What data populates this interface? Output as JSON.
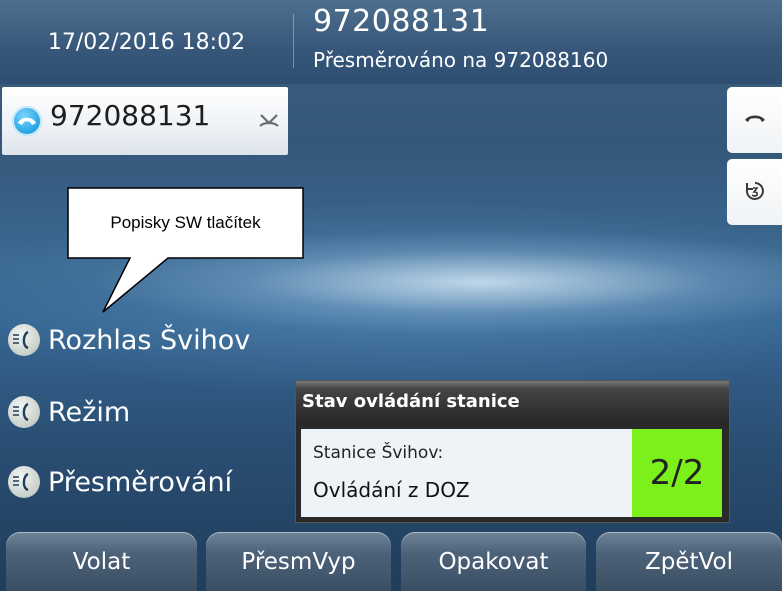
{
  "header": {
    "datetime": "17/02/2016 18:02",
    "caller_number": "972088131",
    "forward_info": "Přesměrováno na 972088160"
  },
  "line": {
    "number": "972088131"
  },
  "callout": {
    "text": "Popisky SW tlačítek"
  },
  "features": [
    {
      "label": "Rozhlas Švihov",
      "icon": "speaker-icon"
    },
    {
      "label": "Režim",
      "icon": "speaker-icon"
    },
    {
      "label": "Přesměrování",
      "icon": "speaker-icon"
    }
  ],
  "status": {
    "title": "Stav ovládání stanice",
    "station": "Stanice Švihov:",
    "mode": "Ovládání z DOZ",
    "count": "2/2"
  },
  "softkeys": [
    "Volat",
    "PřesmVyp",
    "Opakovat",
    "ZpětVol"
  ],
  "colors": {
    "status_count_bg": "#7cf01a",
    "line_icon": "#1a9fe0",
    "softkey": "#4d6379"
  }
}
